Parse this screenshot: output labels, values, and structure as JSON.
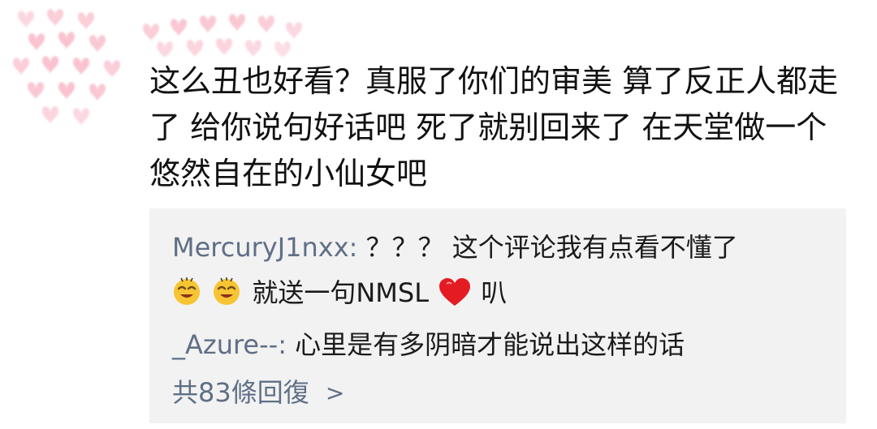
{
  "colors": {
    "username": "#5f6f86",
    "body_text": "#111111",
    "reply_background": "#f2f2f2",
    "heart_pink": "#f26d8b",
    "emoji_yellow": "#f7c532"
  },
  "comment": {
    "text": "这么丑也好看？真服了你们的审美 算了反正人都走了 给你说句好话吧 死了就别回来了 在天堂做一个悠然自在的小仙女吧"
  },
  "replies": [
    {
      "username": "MercuryJ1nxx:",
      "text": "？？？ 这个评论我有点看不懂了",
      "continuation": "就送一句NMSL",
      "ending": "叭",
      "icons": [
        "smiley-emoji",
        "smiley-emoji",
        "red-heart-emoji"
      ]
    },
    {
      "username": "_Azure--:",
      "text": " 心里是有多阴暗才能说出这样的话"
    }
  ],
  "more": {
    "label": "共83條回復",
    "icon": "chevron-right-icon"
  }
}
